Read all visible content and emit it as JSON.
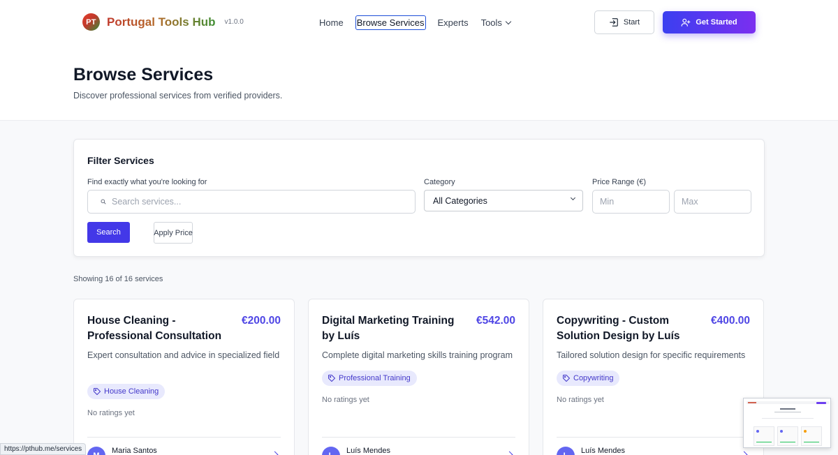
{
  "header": {
    "logo_initials": "PT",
    "brand_name": "Portugal Tools Hub",
    "version": "v1.0.0",
    "nav": [
      {
        "label": "Home"
      },
      {
        "label": "Browse Services"
      },
      {
        "label": "Experts"
      },
      {
        "label": "Tools"
      }
    ],
    "start_label": "Start",
    "get_started_label": "Get Started",
    "accent_gradient": [
      "#3b3ff0",
      "#7b2ff0"
    ]
  },
  "hero": {
    "title": "Browse Services",
    "subtitle": "Discover professional services from verified providers."
  },
  "filter": {
    "title": "Filter Services",
    "search_label": "Find exactly what you're looking for",
    "search_placeholder": "Search services...",
    "category_label": "Category",
    "category_value": "All Categories",
    "price_label": "Price Range (€)",
    "min_placeholder": "Min",
    "max_placeholder": "Max",
    "search_button": "Search",
    "apply_price_button": "Apply Price"
  },
  "results": {
    "count_text": "Showing 16 of 16 services"
  },
  "services": [
    {
      "title": "House Cleaning - Professional Consultation",
      "price": "€200.00",
      "description": "Expert consultation and advice in specialized field",
      "tag": "House Cleaning",
      "rating": "No ratings yet",
      "provider_initial": "M",
      "provider": "Maria Santos"
    },
    {
      "title": "Digital Marketing Training by Luís",
      "price": "€542.00",
      "description": "Complete digital marketing skills training program",
      "tag": "Professional Training",
      "rating": "No ratings yet",
      "provider_initial": "L",
      "provider": "Luís Mendes"
    },
    {
      "title": "Copywriting - Custom Solution Design by Luís",
      "price": "€400.00",
      "description": "Tailored solution design for specific requirements",
      "tag": "Copywriting",
      "rating": "No ratings yet",
      "provider_initial": "L",
      "provider": "Luís Mendes"
    }
  ],
  "status_bar": {
    "url": "https://pthub.me/services"
  },
  "icons": {
    "search": "search-icon",
    "tag": "tag-icon",
    "start": "sign-in-icon",
    "get_started": "user-plus-icon",
    "chevron": "chevron-down-icon",
    "arrow": "chevron-right-icon"
  }
}
